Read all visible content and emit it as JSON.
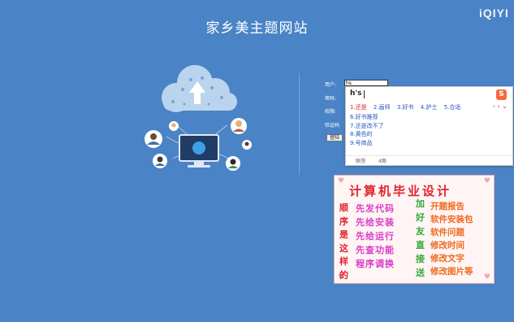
{
  "site": {
    "title": "家乡美主题网站"
  },
  "watermark": {
    "text": "iQIYI"
  },
  "login": {
    "user_label": "用户:",
    "user_value": "hs",
    "pwd_label": "密码:",
    "role_label": "权限:",
    "captcha_label": "验证码",
    "login_button": "登陆"
  },
  "ime": {
    "composition": "h's",
    "logo": "S",
    "candidates_row": [
      "1.还是",
      "2.画师",
      "3.好书",
      "4.护士",
      "5.合适"
    ],
    "candidates_list": [
      "6.好书推荐",
      "7.还是改不了",
      "8.黄色的",
      "9.号商品"
    ],
    "footer": [
      "联想",
      "4图"
    ]
  },
  "poster": {
    "title": "计算机毕业设计",
    "col1": [
      "顺",
      "序",
      "是",
      "这",
      "样",
      "的"
    ],
    "col2": [
      "先发代码",
      "先给安装",
      "先给运行",
      "先查功能",
      "程序调换"
    ],
    "col3": [
      "加",
      "好",
      "友",
      "直",
      "接",
      "送"
    ],
    "col4": [
      "开题报告",
      "软件安装包",
      "软件问题",
      "修改时间",
      "修改文字",
      "修改图片等"
    ]
  },
  "colors": {
    "background": "#4a84c6",
    "poster_red": "#e0242c",
    "ime_blue": "#2356c2"
  }
}
